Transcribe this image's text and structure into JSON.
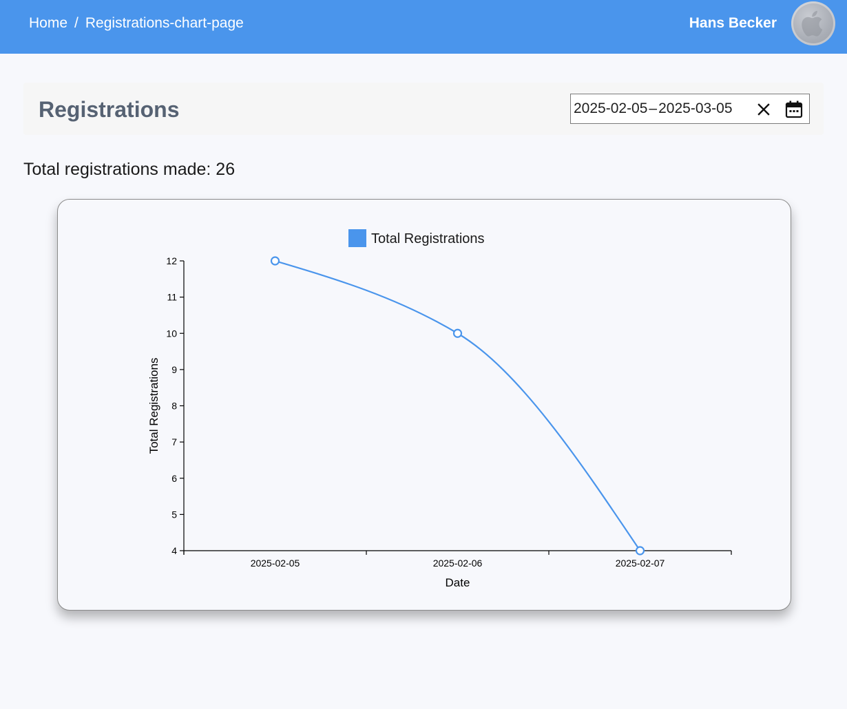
{
  "topbar": {
    "breadcrumb": {
      "home": "Home",
      "separator": "/",
      "current": "Registrations-chart-page"
    },
    "user_name": "Hans Becker",
    "avatar_icon": "apple-logo-icon",
    "background_color": "#4a95ec"
  },
  "header": {
    "title": "Registrations",
    "date_range": {
      "start": "2025-02-05",
      "separator": "–",
      "end": "2025-03-05",
      "clear_icon": "close-icon",
      "calendar_icon": "calendar-icon"
    }
  },
  "summary": {
    "total_text": "Total registrations made: 26"
  },
  "chart_data": {
    "type": "line",
    "categories": [
      "2025-02-05",
      "2025-02-06",
      "2025-02-07"
    ],
    "series": [
      {
        "name": "Total Registrations",
        "values": [
          12,
          10,
          4
        ],
        "color": "#4a95ec"
      }
    ],
    "xlabel": "Date",
    "ylabel": "Total Registrations",
    "ylim": [
      4,
      12
    ],
    "yticks": [
      4,
      5,
      6,
      7,
      8,
      9,
      10,
      11,
      12
    ],
    "legend_position": "top-center",
    "grid": false
  }
}
